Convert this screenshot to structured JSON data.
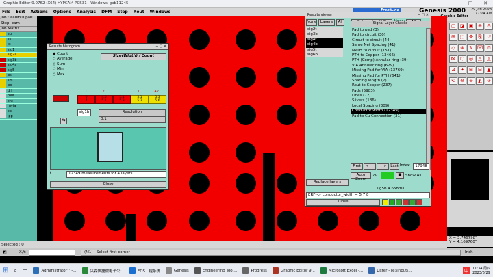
{
  "window": {
    "title": "Graphic Editor 9.0762 (X64) HYPCAM-PCS31 - Windows_gpb11245",
    "min": "─",
    "max": "□",
    "close": "✕"
  },
  "menu": [
    "File",
    "Edit",
    "Actions",
    "Options",
    "Analysis",
    "DFM",
    "Step",
    "Rout",
    "Windows"
  ],
  "brand": {
    "logo": "FrontLine",
    "name": "Genesis 2000",
    "date": "29 Jun 2023",
    "time": "11:14 AM",
    "sub": "Graphic Editor"
  },
  "left": {
    "job": "Job : aa0lb00pa0",
    "step": "Step: cam",
    "matrix": "Job Matrix ..",
    "layers": [
      {
        "n": "cu",
        "c": "#e8d000"
      },
      {
        "n": "ss",
        "c": "#e8d000"
      },
      {
        "n": "ts",
        "c": "#e8d000"
      },
      {
        "n": "sig1",
        "c": "#e8d000"
      },
      {
        "n": "sig2a",
        "c": "#e8d000"
      },
      {
        "n": "sig3b",
        "c": "#c00"
      },
      {
        "n": "sig4a",
        "c": "#c00"
      },
      {
        "n": "sig5",
        "c": "#c00"
      },
      {
        "n": "bs",
        "c": "#e8d000"
      },
      {
        "n": "sm",
        "c": "#e8d000"
      },
      {
        "n": "bo",
        "c": "#e8d000"
      },
      {
        "n": "drl",
        "c": "#ddd"
      },
      {
        "n": "rout",
        "c": "#ddd"
      },
      {
        "n": "cnt",
        "c": "#ddd"
      },
      {
        "n": "mvia",
        "c": "#ddd"
      },
      {
        "n": "cp",
        "c": "#ddd"
      },
      {
        "n": "ipp",
        "c": "#ddd"
      }
    ]
  },
  "histogram": {
    "title": "Results histogram",
    "opts": [
      "Count",
      "Average",
      "Sum",
      "Min",
      "Max"
    ],
    "header": "Size(Width) / Count",
    "scale": [
      "1",
      "2",
      "1",
      "3",
      "42"
    ],
    "bars": [
      "0\n4",
      "4.6\n5.1",
      "5.1\n5.3",
      "5.1\n5.3",
      "5.3\n5.6"
    ],
    "layers": "sig1b",
    "res_label": "Resolution",
    "res_value": "0.1",
    "status": "12349 measurements for 4 layers",
    "close": "Close"
  },
  "viewer": {
    "title": "Results viewer",
    "tab_none": "None",
    "tab_layers": "Layers",
    "tab_all": "All",
    "categories_label": "Categories (18)",
    "meas_label": "Meas:",
    "meas_val": "All",
    "panel_title": "Signal Layer Checks",
    "sigs": [
      "sig2t",
      "sig3b",
      "sig4t",
      "sig4b",
      "sig5t",
      "sig6b"
    ],
    "cats": [
      "Pad to pad (3)",
      "Pad to circuit (30)",
      "Circuit to circuit (44)",
      "Same Net Spacing (41)",
      "NPTH to circuit (151)",
      "PTH to Copper (13466)",
      "PTH (Comp) Annular ring (39)",
      "VIA Annular ring (629)",
      "Missing Pad for VIA (13769)",
      "Missing Pad for PTH (641)",
      "Spacing length (7)",
      "Rout to Copper (237)",
      "Pads (5983)",
      "Lines (72)",
      "Slivers (186)",
      "Local Spacing (309)",
      "Conductor width (12349)",
      "Pad to Cu Connection (31)"
    ],
    "first": "First",
    "prev": "<----",
    "next": "---->",
    "last": "Last",
    "index_label": "Index:",
    "index_val": "17948",
    "auto": "Auto Zoom",
    "zv": "Zv",
    "show_all": "Show All",
    "replace": "Replace layers",
    "status": "sig5b 4.658mil",
    "result": "ERF--> conductor_width = 5 7 8",
    "close": "Close"
  },
  "status": {
    "selected": "Selected : 0",
    "cmd": "(M1) - Select first corner",
    "xy": "X,Y:",
    "inch": "Inch"
  },
  "coords": {
    "x": "X = 3.746798\"",
    "y": "Y = 4.169760\""
  },
  "taskbar": [
    {
      "t": "Administrator^ -...",
      "c": "#2d6fb7"
    },
    {
      "t": "兴森快捷微电子公...",
      "c": "#2a8a3a"
    },
    {
      "t": "EDS工程系统",
      "c": "#1a6fd1"
    },
    {
      "t": "Genesis",
      "c": "#888"
    },
    {
      "t": "Engineering Tool...",
      "c": "#555"
    },
    {
      "t": "Progress",
      "c": "#666"
    },
    {
      "t": "Graphic Editor 9...",
      "c": "#aa3322"
    },
    {
      "t": "Microsoft Excel -...",
      "c": "#1d7a3e"
    },
    {
      "t": "Lister - [e:\\input\\...",
      "c": "#3366aa"
    }
  ],
  "clock": {
    "time": "11:34 周四",
    "date": "2023/6/29"
  }
}
